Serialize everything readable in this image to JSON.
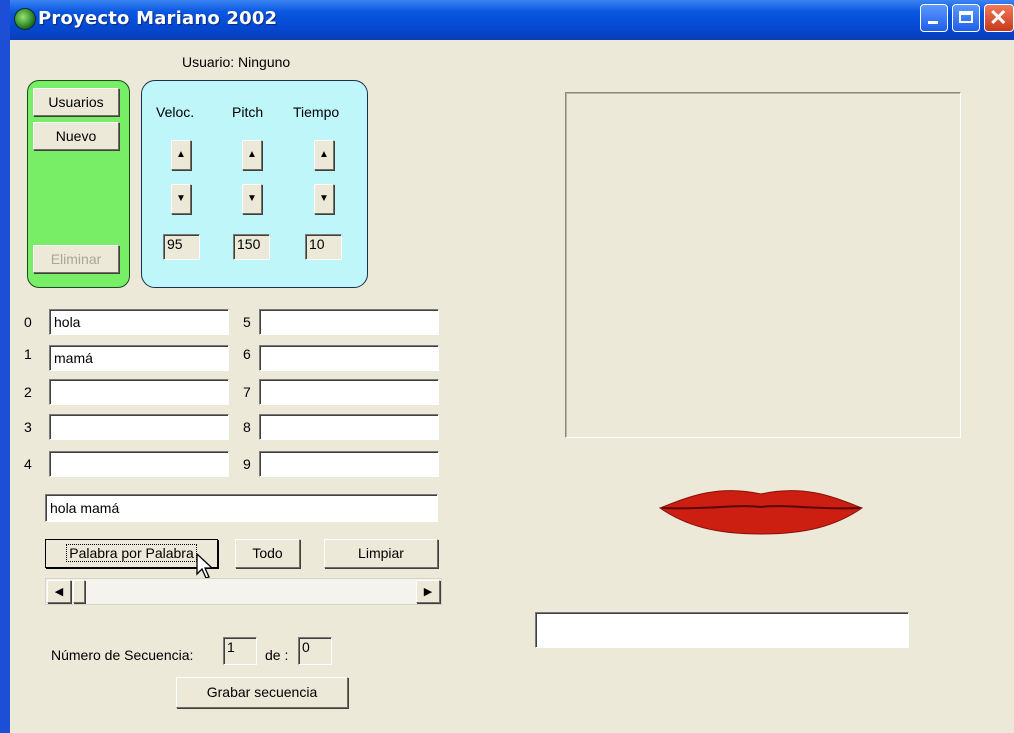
{
  "window": {
    "title": "Proyecto Mariano 2002",
    "colors": {
      "titlebar": "#0548d0",
      "frame": "#1d4fd6",
      "face": "#ece9d8"
    }
  },
  "user_label": "Usuario: Ninguno",
  "user_panel": {
    "color": "#78ee66",
    "usuarios_label": "Usuarios",
    "nuevo_label": "Nuevo",
    "eliminar_label": "Eliminar"
  },
  "voice_panel": {
    "color": "#bff6f9",
    "controls": [
      {
        "label": "Veloc.",
        "value": "95"
      },
      {
        "label": "Pitch",
        "value": "150"
      },
      {
        "label": "Tiempo",
        "value": "10"
      }
    ]
  },
  "words": [
    {
      "index": "0",
      "value": "hola"
    },
    {
      "index": "1",
      "value": "mamá"
    },
    {
      "index": "2",
      "value": ""
    },
    {
      "index": "3",
      "value": ""
    },
    {
      "index": "4",
      "value": ""
    },
    {
      "index": "5",
      "value": ""
    },
    {
      "index": "6",
      "value": ""
    },
    {
      "index": "7",
      "value": ""
    },
    {
      "index": "8",
      "value": ""
    },
    {
      "index": "9",
      "value": ""
    }
  ],
  "sentence": "hola mamá",
  "actions": {
    "palabra_label": "Palabra por Palabra",
    "todo_label": "Todo",
    "limpiar_label": "Limpiar"
  },
  "scrollbar": {
    "left_icon": "arrow-left-icon",
    "right_icon": "arrow-right-icon",
    "position": 0
  },
  "sequence": {
    "numero_label": "Número de Secuencia:",
    "numero_value": "1",
    "de_label": "de :",
    "de_value": "0",
    "grabar_label": "Grabar secuencia"
  },
  "lips": {
    "icon": "lips-icon",
    "color": "#cc1f12"
  },
  "output_text": ""
}
